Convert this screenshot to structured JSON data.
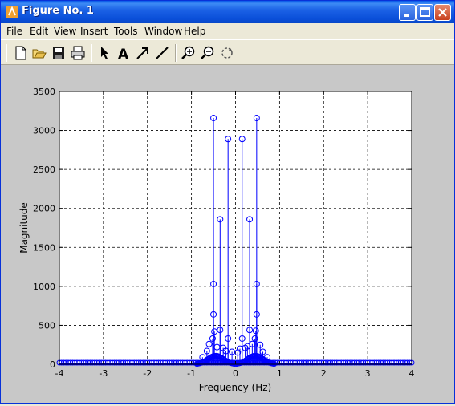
{
  "window": {
    "title": "Figure No. 1"
  },
  "menu": [
    "File",
    "Edit",
    "View",
    "Insert",
    "Tools",
    "Window",
    "Help"
  ],
  "toolbar": {
    "buttons": [
      "new-figure-icon",
      "open-file-icon",
      "save-icon",
      "print-icon",
      "select-arrow-icon",
      "insert-text-icon",
      "insert-arrow-icon",
      "insert-line-icon",
      "zoom-in-icon",
      "zoom-out-icon",
      "rotate-3d-icon"
    ]
  },
  "colors": {
    "stem": "#0000ff",
    "titlebar": "#0a4fd9",
    "figure_bg": "#c8c8c8"
  },
  "chart_data": {
    "type": "stem",
    "title": "",
    "xlabel": "Frequency (Hz)",
    "ylabel": "Magnitude",
    "xlim": [
      -4,
      4
    ],
    "ylim": [
      0,
      3500
    ],
    "xticks": [
      "-4",
      "-3",
      "-2",
      "-1",
      "0",
      "1",
      "2",
      "3",
      "4"
    ],
    "yticks": [
      "0",
      "500",
      "1000",
      "1500",
      "2000",
      "2500",
      "3000",
      "3500"
    ],
    "grid": true,
    "points": [
      {
        "x": -0.5,
        "y": 3160
      },
      {
        "x": -0.5,
        "y": 1030
      },
      {
        "x": -0.5,
        "y": 640
      },
      {
        "x": -0.48,
        "y": 420
      },
      {
        "x": -0.52,
        "y": 330
      },
      {
        "x": -0.35,
        "y": 1860
      },
      {
        "x": -0.35,
        "y": 440
      },
      {
        "x": -0.17,
        "y": 2890
      },
      {
        "x": -0.17,
        "y": 330
      },
      {
        "x": 0.15,
        "y": 2890
      },
      {
        "x": 0.15,
        "y": 330
      },
      {
        "x": 0.32,
        "y": 1860
      },
      {
        "x": 0.32,
        "y": 440
      },
      {
        "x": 0.48,
        "y": 3160
      },
      {
        "x": 0.48,
        "y": 1030
      },
      {
        "x": 0.48,
        "y": 640
      },
      {
        "x": 0.46,
        "y": 430
      },
      {
        "x": 0.44,
        "y": 330
      },
      {
        "x": -0.6,
        "y": 260
      },
      {
        "x": -0.42,
        "y": 220
      },
      {
        "x": -0.28,
        "y": 210
      },
      {
        "x": -0.22,
        "y": 170
      },
      {
        "x": -0.08,
        "y": 160
      },
      {
        "x": 0.05,
        "y": 150
      },
      {
        "x": 0.1,
        "y": 200
      },
      {
        "x": 0.22,
        "y": 210
      },
      {
        "x": 0.27,
        "y": 230
      },
      {
        "x": 0.38,
        "y": 260
      },
      {
        "x": 0.56,
        "y": 250
      },
      {
        "x": -0.65,
        "y": 170
      },
      {
        "x": 0.62,
        "y": 160
      },
      {
        "x": -0.75,
        "y": 90
      },
      {
        "x": 0.72,
        "y": 90
      }
    ]
  }
}
